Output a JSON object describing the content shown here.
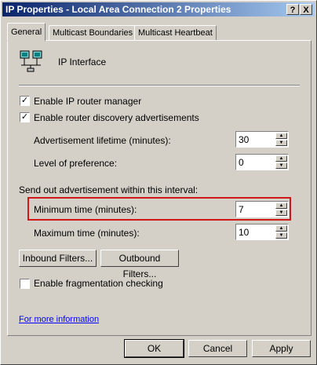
{
  "window": {
    "title": "IP Properties - Local Area Connection 2 Properties",
    "help_label": "?",
    "close_label": "X"
  },
  "tabs": [
    {
      "label": "General"
    },
    {
      "label": "Multicast Boundaries"
    },
    {
      "label": "Multicast Heartbeat"
    }
  ],
  "header": {
    "label": "IP Interface"
  },
  "options": {
    "enable_ip_router_manager": {
      "label": "Enable IP router manager",
      "checked": "✓"
    },
    "enable_router_discovery": {
      "label": "Enable router discovery advertisements",
      "checked": "✓"
    },
    "enable_fragmentation": {
      "label": "Enable fragmentation checking",
      "checked": ""
    }
  },
  "fields": {
    "advertisement_lifetime": {
      "label": "Advertisement lifetime (minutes):",
      "value": "30"
    },
    "level_of_preference": {
      "label": "Level of preference:",
      "value": "0"
    },
    "interval_caption": "Send out advertisement within this interval:",
    "minimum_time": {
      "label": "Minimum time (minutes):",
      "value": "7"
    },
    "maximum_time": {
      "label": "Maximum time (minutes):",
      "value": "10"
    }
  },
  "filters": {
    "inbound_label": "Inbound Filters...",
    "outbound_label": "Outbound Filters..."
  },
  "link": {
    "label": "For more information"
  },
  "footer": {
    "ok_label": "OK",
    "cancel_label": "Cancel",
    "apply_label": "Apply"
  },
  "colors": {
    "highlight": "#d01818",
    "titlebar": "#0a246a",
    "link": "#0000ff"
  },
  "spin": {
    "up": "▲",
    "down": "▼"
  }
}
